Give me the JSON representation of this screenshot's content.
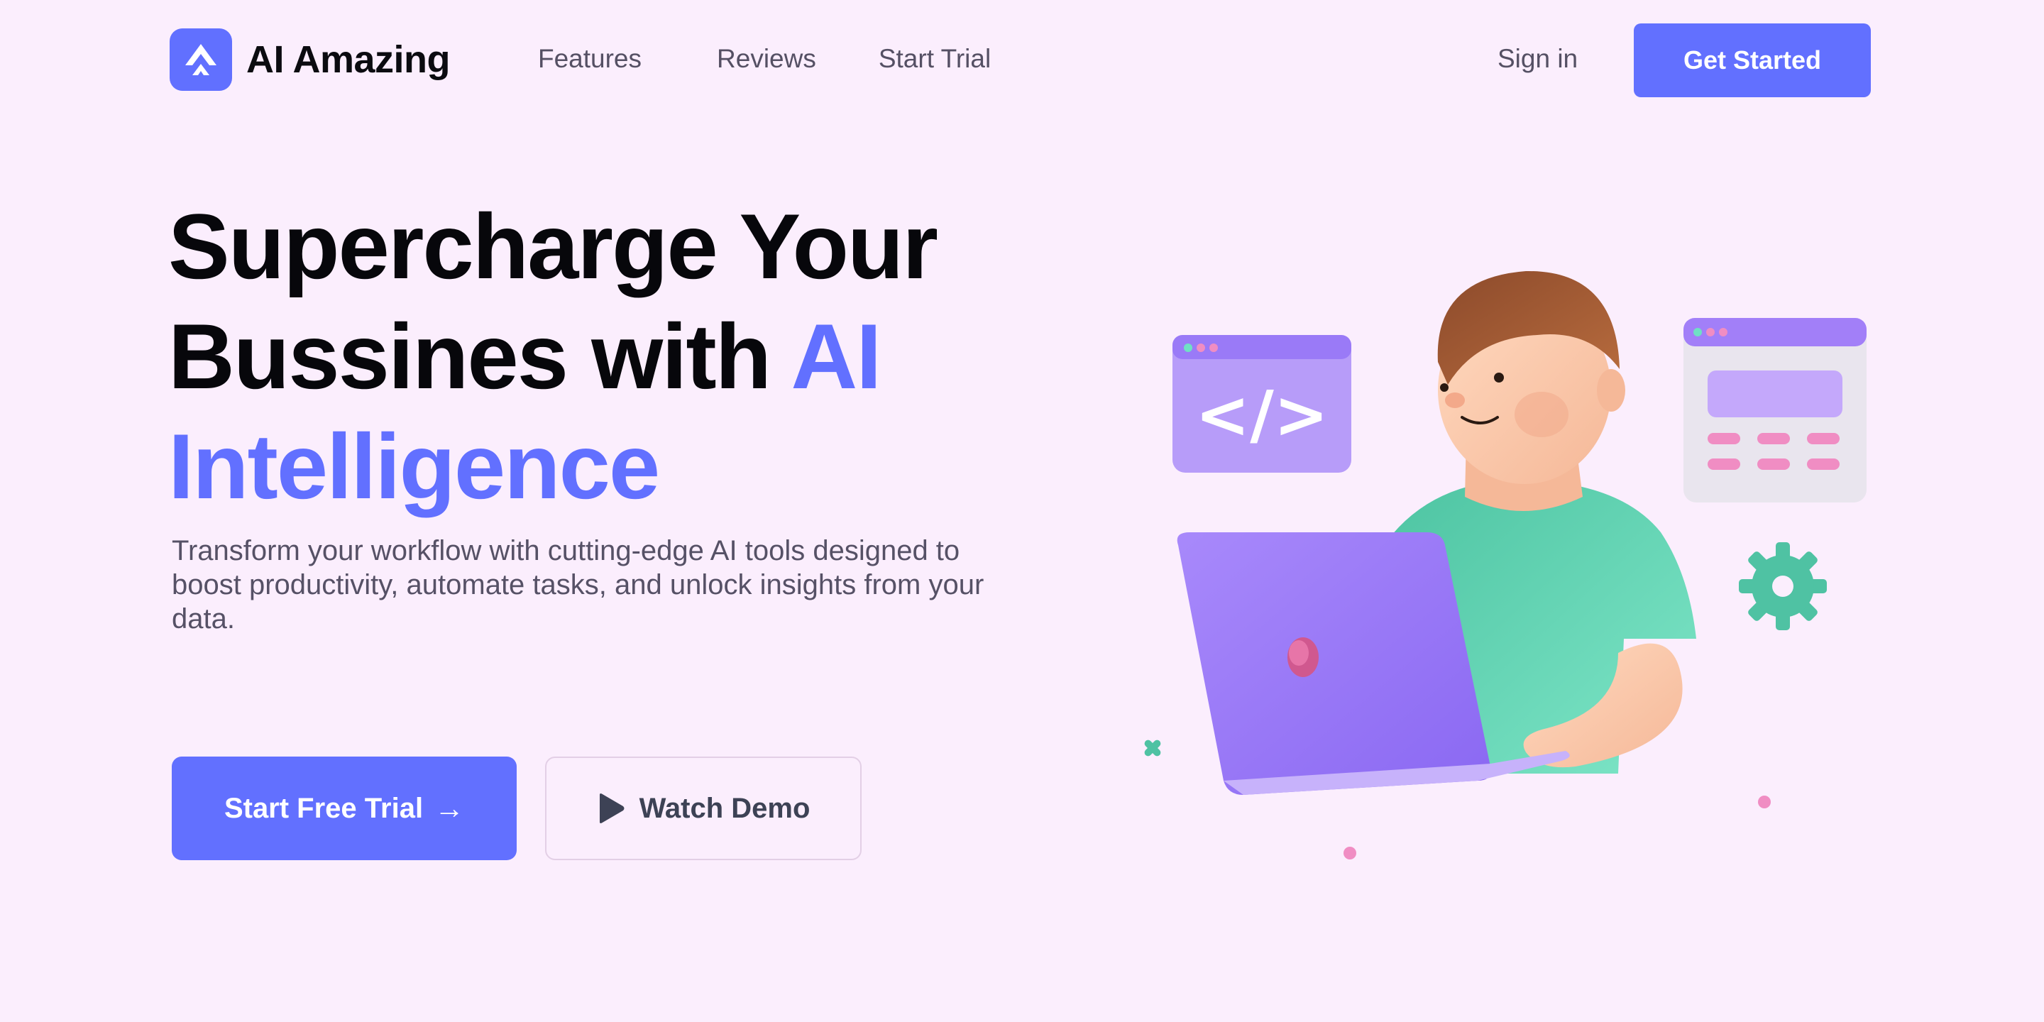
{
  "brand": {
    "name": "AI Amazing",
    "color": "#6270ff"
  },
  "nav": {
    "links": [
      "Features",
      "Reviews",
      "Start Trial"
    ],
    "sign_in": "Sign in",
    "cta": "Get Started"
  },
  "hero": {
    "line1": "Supercharge Your",
    "line2_plain": "Bussines with ",
    "line2_accent": "AI",
    "line3_accent": "Intelligence",
    "subtext": "Transform your workflow with cutting-edge AI tools designed to boost productivity, automate tasks, and unlock insights from your data.",
    "primary_cta": "Start Free Trial",
    "primary_cta_icon": "arrow-right-icon",
    "secondary_cta": "Watch Demo",
    "secondary_cta_icon": "play-icon"
  },
  "illustration": {
    "code_window_symbol": "</>",
    "colors": {
      "laptop": "#9a7af7",
      "shirt": "#5fd1b0",
      "gear": "#4fc2a3",
      "window": "#b79cf9",
      "pink": "#f08dc3"
    }
  }
}
